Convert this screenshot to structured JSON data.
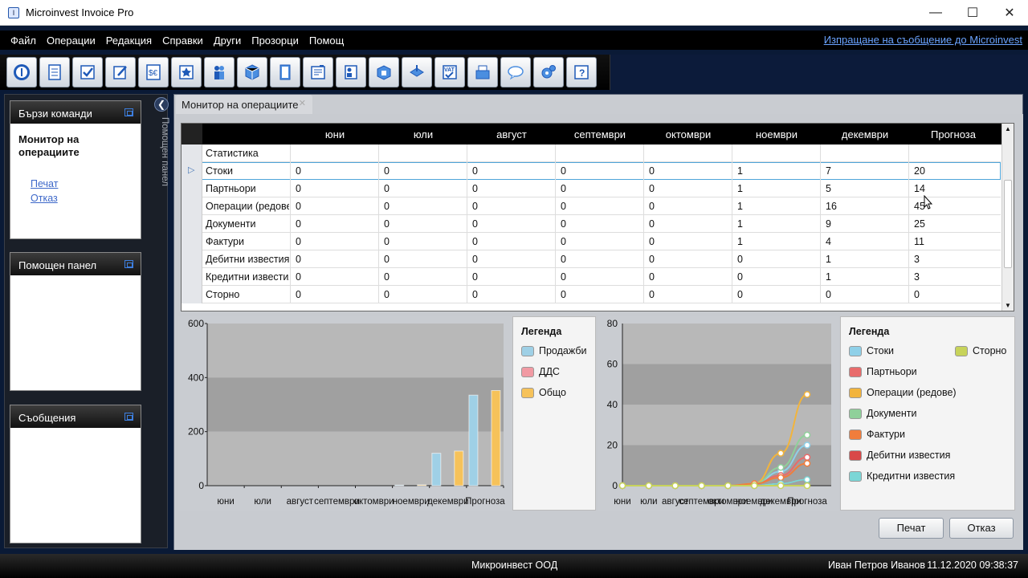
{
  "window": {
    "title": "Microinvest Invoice Pro",
    "icon": "app-icon",
    "controls": [
      "minimize",
      "maximize",
      "close"
    ]
  },
  "menu": {
    "items": [
      "Файл",
      "Операции",
      "Редакция",
      "Справки",
      "Други",
      "Прозорци",
      "Помощ"
    ],
    "link": "Изпращане на съобщение до Microinvest"
  },
  "toolbar": {
    "icons": [
      "info-icon",
      "document-icon",
      "checkmark-icon",
      "edit-icon",
      "currency-icon",
      "star-icon",
      "people-icon",
      "cube-icon",
      "book-icon",
      "report-icon",
      "contacts-icon",
      "box-icon",
      "export-icon",
      "vat-icon",
      "cash-register-icon",
      "chat-icon",
      "settings-icon",
      "help-icon"
    ]
  },
  "left": {
    "quick": {
      "title": "Бързи команди",
      "heading": "Монитор на операциите",
      "links": [
        "Печат",
        "Отказ"
      ]
    },
    "help": {
      "title": "Помощен панел"
    },
    "messages": {
      "title": "Съобщения"
    },
    "vertical_tab": "Помощен панел"
  },
  "tab": {
    "label": "Монитор на операциите"
  },
  "grid": {
    "columns": [
      "юни",
      "юли",
      "август",
      "септември",
      "октомври",
      "ноември",
      "декември",
      "Прогноза"
    ],
    "rows": [
      {
        "label": "Статистика",
        "values": [
          "",
          "",
          "",
          "",
          "",
          "",
          "",
          ""
        ]
      },
      {
        "label": "Стоки",
        "values": [
          "0",
          "0",
          "0",
          "0",
          "0",
          "1",
          "7",
          "20"
        ],
        "selected": true
      },
      {
        "label": "Партньори",
        "values": [
          "0",
          "0",
          "0",
          "0",
          "0",
          "1",
          "5",
          "14"
        ]
      },
      {
        "label": "Операции (редове)",
        "values": [
          "0",
          "0",
          "0",
          "0",
          "0",
          "1",
          "16",
          "45"
        ]
      },
      {
        "label": "Документи",
        "values": [
          "0",
          "0",
          "0",
          "0",
          "0",
          "1",
          "9",
          "25"
        ]
      },
      {
        "label": "Фактури",
        "values": [
          "0",
          "0",
          "0",
          "0",
          "0",
          "1",
          "4",
          "11"
        ]
      },
      {
        "label": "Дебитни известия",
        "values": [
          "0",
          "0",
          "0",
          "0",
          "0",
          "0",
          "1",
          "3"
        ]
      },
      {
        "label": "Кредитни известия",
        "values": [
          "0",
          "0",
          "0",
          "0",
          "0",
          "0",
          "1",
          "3"
        ]
      },
      {
        "label": "Сторно",
        "values": [
          "0",
          "0",
          "0",
          "0",
          "0",
          "0",
          "0",
          "0"
        ]
      }
    ]
  },
  "chart_data": [
    {
      "type": "bar",
      "categories": [
        "юни",
        "юли",
        "август",
        "септември",
        "октомври",
        "ноември",
        "декември",
        "Прогноза"
      ],
      "series": [
        {
          "name": "Продажби",
          "values": [
            0,
            0,
            0,
            0,
            0,
            2,
            120,
            335
          ],
          "color": "#9fd0e6"
        },
        {
          "name": "ДДС",
          "values": [
            0,
            0,
            0,
            0,
            0,
            0,
            0,
            0
          ],
          "color": "#f19aa3"
        },
        {
          "name": "Общо",
          "values": [
            0,
            0,
            0,
            0,
            0,
            3,
            128,
            352
          ],
          "color": "#f6c25a"
        }
      ],
      "ylim": [
        0,
        600
      ],
      "yticks": [
        "0",
        "200",
        "400",
        "600"
      ],
      "legend_title": "Легенда"
    },
    {
      "type": "line",
      "categories": [
        "юни",
        "юли",
        "август",
        "септември",
        "октомври",
        "ноември",
        "декември",
        "Прогноза"
      ],
      "series": [
        {
          "name": "Стоки",
          "values": [
            0,
            0,
            0,
            0,
            0,
            1,
            7,
            20
          ],
          "color": "#8fd0e8"
        },
        {
          "name": "Партньори",
          "values": [
            0,
            0,
            0,
            0,
            0,
            1,
            5,
            14
          ],
          "color": "#e86b6b"
        },
        {
          "name": "Операции (редове)",
          "values": [
            0,
            0,
            0,
            0,
            0,
            1,
            16,
            45
          ],
          "color": "#f2b43c"
        },
        {
          "name": "Документи",
          "values": [
            0,
            0,
            0,
            0,
            0,
            1,
            9,
            25
          ],
          "color": "#8fd09a"
        },
        {
          "name": "Фактури",
          "values": [
            0,
            0,
            0,
            0,
            0,
            1,
            4,
            11
          ],
          "color": "#f07d3c"
        },
        {
          "name": "Дебитни известия",
          "values": [
            0,
            0,
            0,
            0,
            0,
            0,
            1,
            3
          ],
          "color": "#d94848"
        },
        {
          "name": "Кредитни известия",
          "values": [
            0,
            0,
            0,
            0,
            0,
            0,
            1,
            3
          ],
          "color": "#7bd6d6"
        },
        {
          "name": "Сторно",
          "values": [
            0,
            0,
            0,
            0,
            0,
            0,
            0,
            0
          ],
          "color": "#c7d35a"
        }
      ],
      "ylim": [
        0,
        80
      ],
      "yticks": [
        "0",
        "20",
        "40",
        "60",
        "80"
      ],
      "legend_title": "Легенда"
    }
  ],
  "buttons": {
    "print": "Печат",
    "cancel": "Отказ"
  },
  "status": {
    "company": "Микроинвест ООД",
    "user": "Иван Петров Иванов",
    "datetime": "11.12.2020 09:38:37"
  }
}
